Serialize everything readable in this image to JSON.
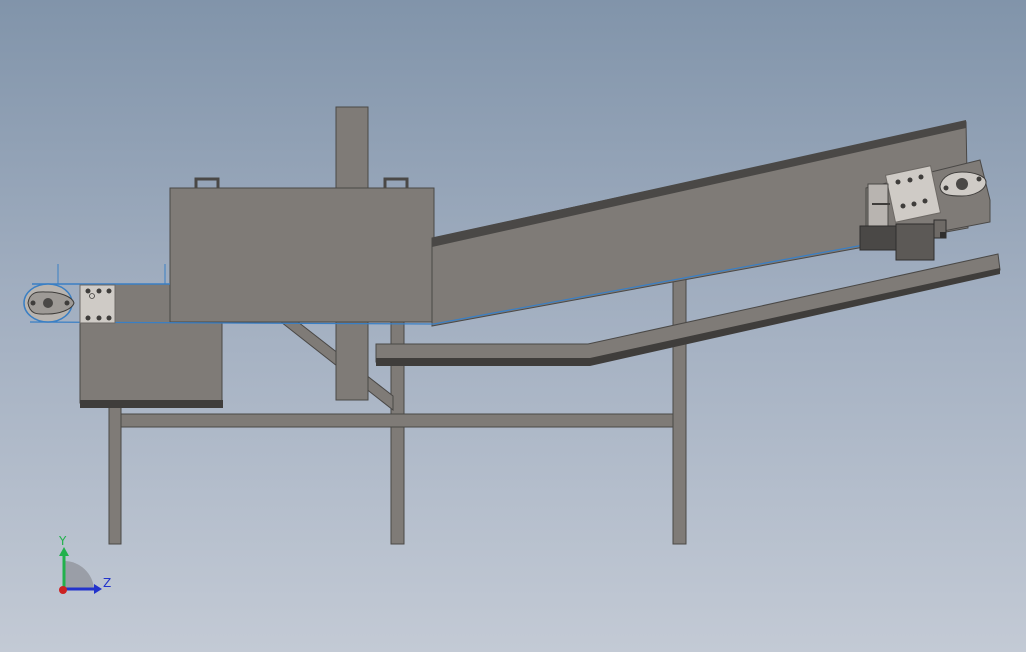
{
  "viewport": {
    "background_top": "#8194aa",
    "background_bottom": "#c3cad5"
  },
  "model": {
    "body_color": "#7f7b77",
    "edge_color": "#4a4846",
    "shadow_color": "#3f3d3b",
    "belt_color": "#3a7fc4",
    "component_color": "#9e9a96",
    "light_color": "#cfcbc6"
  },
  "triad": {
    "y_label": "Y",
    "z_label": "Z",
    "y_color": "#22b14c",
    "z_color": "#2233cc",
    "x_color": "#cc2222"
  }
}
